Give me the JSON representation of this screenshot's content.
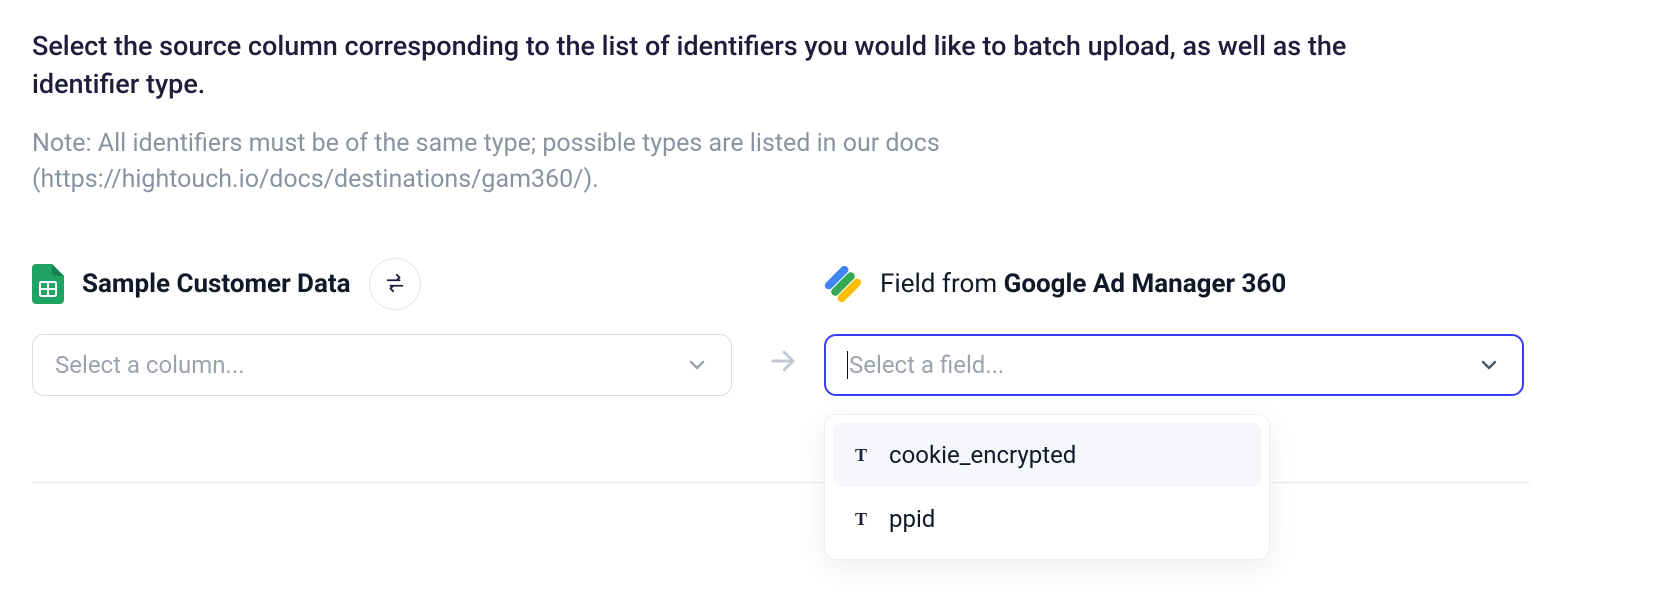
{
  "heading": "Select the source column corresponding to the list of identifiers you would like to batch upload, as well as the identifier type.",
  "subnote": "Note: All identifiers must be of the same type; possible types are listed in our docs (https://hightouch.io/docs/destinations/gam360/).",
  "source": {
    "label": "Sample Customer Data",
    "select_placeholder": "Select a column..."
  },
  "destination": {
    "prefix": "Field from ",
    "name_bold": "Google Ad Manager 360",
    "select_placeholder": "Select a field...",
    "options": [
      {
        "type_glyph": "T",
        "label": "cookie_encrypted",
        "highlighted": true
      },
      {
        "type_glyph": "T",
        "label": "ppid",
        "highlighted": false
      }
    ]
  }
}
